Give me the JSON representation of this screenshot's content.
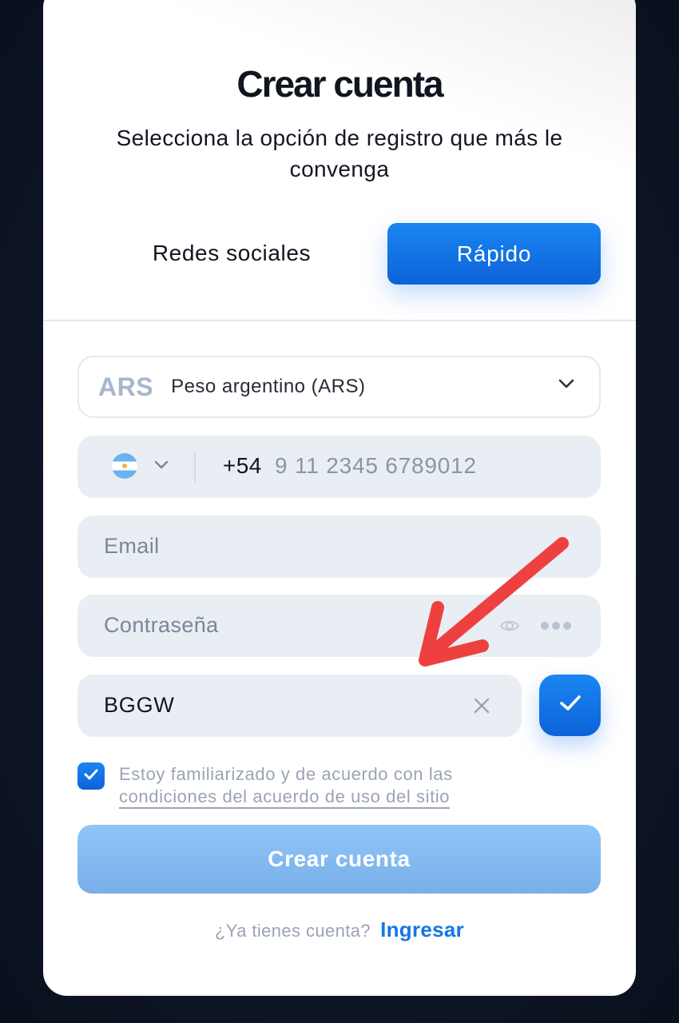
{
  "modal": {
    "title": "Crear cuenta",
    "subtitle": "Selecciona la opción de registro que más le convenga"
  },
  "tabs": {
    "social_label": "Redes sociales",
    "quick_label": "Rápido",
    "active": "Rápido"
  },
  "currency": {
    "code": "ARS",
    "name": "Peso argentino (ARS)",
    "icon": "chevron-down-icon"
  },
  "phone": {
    "flag": "argentina-flag-icon",
    "prefix": "+54",
    "placeholder": "9 11 2345 6789012"
  },
  "email": {
    "placeholder": "Email"
  },
  "password": {
    "placeholder": "Contraseña",
    "icons": [
      "eye-icon",
      "more-dots-icon"
    ]
  },
  "captcha": {
    "value": "BGGW",
    "clear_icon": "close-icon",
    "confirm_icon": "checkmark-icon"
  },
  "agreement": {
    "checked": true,
    "line1": "Estoy familiarizado y de acuerdo con las",
    "line2": "condiciones del acuerdo de uso del sitio"
  },
  "submit_label": "Crear cuenta",
  "login": {
    "question": "¿Ya tienes cuenta?",
    "link_label": "Ingresar"
  },
  "colors": {
    "accent": "#1676e3",
    "annotation_arrow": "#ef4040",
    "background": "#0d1424"
  }
}
